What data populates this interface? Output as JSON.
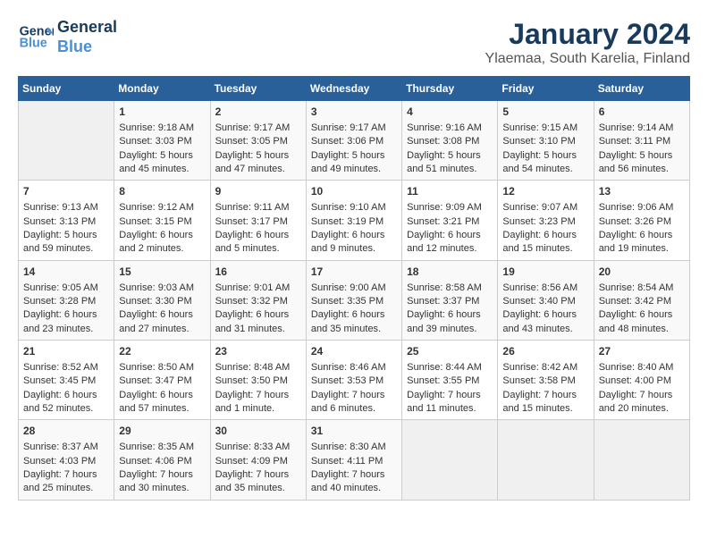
{
  "header": {
    "logo_line1": "General",
    "logo_line2": "Blue",
    "title": "January 2024",
    "subtitle": "Ylaemaa, South Karelia, Finland"
  },
  "days_of_week": [
    "Sunday",
    "Monday",
    "Tuesday",
    "Wednesday",
    "Thursday",
    "Friday",
    "Saturday"
  ],
  "weeks": [
    [
      {
        "day": "",
        "content": ""
      },
      {
        "day": "1",
        "content": "Sunrise: 9:18 AM\nSunset: 3:03 PM\nDaylight: 5 hours\nand 45 minutes."
      },
      {
        "day": "2",
        "content": "Sunrise: 9:17 AM\nSunset: 3:05 PM\nDaylight: 5 hours\nand 47 minutes."
      },
      {
        "day": "3",
        "content": "Sunrise: 9:17 AM\nSunset: 3:06 PM\nDaylight: 5 hours\nand 49 minutes."
      },
      {
        "day": "4",
        "content": "Sunrise: 9:16 AM\nSunset: 3:08 PM\nDaylight: 5 hours\nand 51 minutes."
      },
      {
        "day": "5",
        "content": "Sunrise: 9:15 AM\nSunset: 3:10 PM\nDaylight: 5 hours\nand 54 minutes."
      },
      {
        "day": "6",
        "content": "Sunrise: 9:14 AM\nSunset: 3:11 PM\nDaylight: 5 hours\nand 56 minutes."
      }
    ],
    [
      {
        "day": "7",
        "content": "Sunrise: 9:13 AM\nSunset: 3:13 PM\nDaylight: 5 hours\nand 59 minutes."
      },
      {
        "day": "8",
        "content": "Sunrise: 9:12 AM\nSunset: 3:15 PM\nDaylight: 6 hours\nand 2 minutes."
      },
      {
        "day": "9",
        "content": "Sunrise: 9:11 AM\nSunset: 3:17 PM\nDaylight: 6 hours\nand 5 minutes."
      },
      {
        "day": "10",
        "content": "Sunrise: 9:10 AM\nSunset: 3:19 PM\nDaylight: 6 hours\nand 9 minutes."
      },
      {
        "day": "11",
        "content": "Sunrise: 9:09 AM\nSunset: 3:21 PM\nDaylight: 6 hours\nand 12 minutes."
      },
      {
        "day": "12",
        "content": "Sunrise: 9:07 AM\nSunset: 3:23 PM\nDaylight: 6 hours\nand 15 minutes."
      },
      {
        "day": "13",
        "content": "Sunrise: 9:06 AM\nSunset: 3:26 PM\nDaylight: 6 hours\nand 19 minutes."
      }
    ],
    [
      {
        "day": "14",
        "content": "Sunrise: 9:05 AM\nSunset: 3:28 PM\nDaylight: 6 hours\nand 23 minutes."
      },
      {
        "day": "15",
        "content": "Sunrise: 9:03 AM\nSunset: 3:30 PM\nDaylight: 6 hours\nand 27 minutes."
      },
      {
        "day": "16",
        "content": "Sunrise: 9:01 AM\nSunset: 3:32 PM\nDaylight: 6 hours\nand 31 minutes."
      },
      {
        "day": "17",
        "content": "Sunrise: 9:00 AM\nSunset: 3:35 PM\nDaylight: 6 hours\nand 35 minutes."
      },
      {
        "day": "18",
        "content": "Sunrise: 8:58 AM\nSunset: 3:37 PM\nDaylight: 6 hours\nand 39 minutes."
      },
      {
        "day": "19",
        "content": "Sunrise: 8:56 AM\nSunset: 3:40 PM\nDaylight: 6 hours\nand 43 minutes."
      },
      {
        "day": "20",
        "content": "Sunrise: 8:54 AM\nSunset: 3:42 PM\nDaylight: 6 hours\nand 48 minutes."
      }
    ],
    [
      {
        "day": "21",
        "content": "Sunrise: 8:52 AM\nSunset: 3:45 PM\nDaylight: 6 hours\nand 52 minutes."
      },
      {
        "day": "22",
        "content": "Sunrise: 8:50 AM\nSunset: 3:47 PM\nDaylight: 6 hours\nand 57 minutes."
      },
      {
        "day": "23",
        "content": "Sunrise: 8:48 AM\nSunset: 3:50 PM\nDaylight: 7 hours\nand 1 minute."
      },
      {
        "day": "24",
        "content": "Sunrise: 8:46 AM\nSunset: 3:53 PM\nDaylight: 7 hours\nand 6 minutes."
      },
      {
        "day": "25",
        "content": "Sunrise: 8:44 AM\nSunset: 3:55 PM\nDaylight: 7 hours\nand 11 minutes."
      },
      {
        "day": "26",
        "content": "Sunrise: 8:42 AM\nSunset: 3:58 PM\nDaylight: 7 hours\nand 15 minutes."
      },
      {
        "day": "27",
        "content": "Sunrise: 8:40 AM\nSunset: 4:00 PM\nDaylight: 7 hours\nand 20 minutes."
      }
    ],
    [
      {
        "day": "28",
        "content": "Sunrise: 8:37 AM\nSunset: 4:03 PM\nDaylight: 7 hours\nand 25 minutes."
      },
      {
        "day": "29",
        "content": "Sunrise: 8:35 AM\nSunset: 4:06 PM\nDaylight: 7 hours\nand 30 minutes."
      },
      {
        "day": "30",
        "content": "Sunrise: 8:33 AM\nSunset: 4:09 PM\nDaylight: 7 hours\nand 35 minutes."
      },
      {
        "day": "31",
        "content": "Sunrise: 8:30 AM\nSunset: 4:11 PM\nDaylight: 7 hours\nand 40 minutes."
      },
      {
        "day": "",
        "content": ""
      },
      {
        "day": "",
        "content": ""
      },
      {
        "day": "",
        "content": ""
      }
    ]
  ]
}
